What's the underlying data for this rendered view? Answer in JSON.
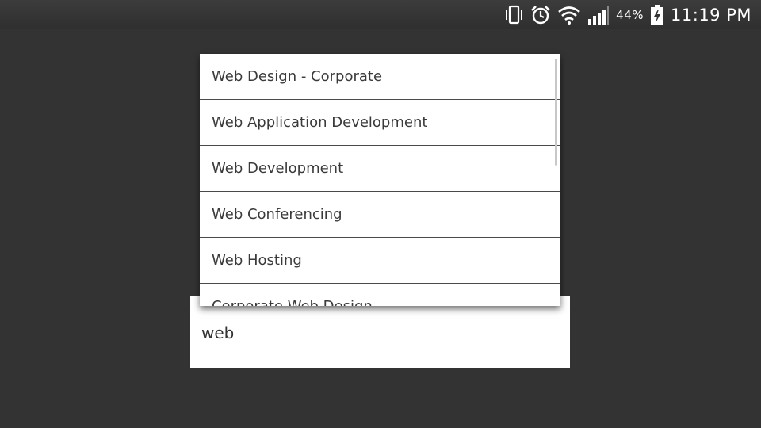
{
  "status_bar": {
    "battery_percent": "44%",
    "time": "11:19 PM",
    "icons": [
      "vibrate-icon",
      "alarm-icon",
      "wifi-icon",
      "signal-icon",
      "battery-charging-icon"
    ]
  },
  "background_title": "",
  "search": {
    "value": "web",
    "placeholder": ""
  },
  "suggestions": {
    "items": [
      "Web Design - Corporate",
      "Web Application Development",
      "Web Development",
      "Web Conferencing",
      "Web Hosting",
      "Corporate Web Design"
    ]
  },
  "colors": {
    "background": "#333333",
    "status_bar": "#363636",
    "dropdown_bg": "#ffffff",
    "divider": "#4a4a4a",
    "text": "#3a3a3a"
  }
}
